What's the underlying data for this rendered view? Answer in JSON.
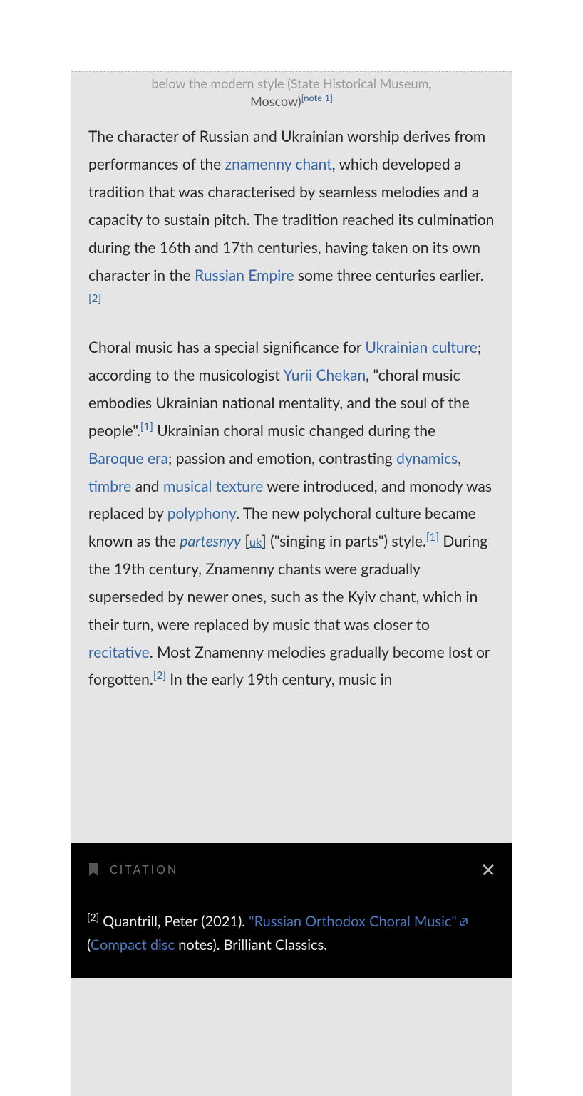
{
  "caption": {
    "line1_prefix": "below the modern style (",
    "link1": "State Historical Museum",
    "line2_after_link": ", Moscow)",
    "note_ref": "[note 1]"
  },
  "para1": {
    "t1": "The character of Russian and Ukrainian worship derives from performances of the ",
    "link_znamenny": "znamenny chant",
    "t2": ", which developed a tradition that was characterised by seamless melodies and a capacity to sustain pitch. The tradition reached its culmination during the 16th and 17th centuries, having taken on its own character in the ",
    "link_russian_empire": "Russian Empire",
    "t3": " some three centuries earlier.",
    "ref2": "[2]"
  },
  "para2": {
    "t1": "Choral music has a special significance for ",
    "link_ukr_culture": "Ukrainian culture",
    "t2": "; according to the musicologist ",
    "link_chek": "Yurii Chekan",
    "t3": ", \"choral music embodies Ukrainian national mentality, and the soul of the people\".",
    "ref1a": "[1]",
    "t4": " Ukrainian choral music changed during the ",
    "link_baroque": "Baroque era",
    "t5": "; passion and emotion, contrasting ",
    "link_dynamics": "dynamics",
    "t6": ", ",
    "link_timbre": "timbre",
    "t7": " and ",
    "link_texture": "musical texture",
    "t8": " were introduced, and monody was replaced by ",
    "link_polyphony": "polyphony",
    "t9": ". The new polychoral culture became known as the ",
    "ital_partesnyy": "partesnyy",
    "t10": " [",
    "uk": "uk",
    "t11": "] (\"singing in parts\") style.",
    "ref1b": "[1]",
    "t12": " During the 19th century, Znamenny chants were gradually superseded by newer ones, such as the Kyiv chant, which in their turn, were replaced by music that was closer to ",
    "link_recitative": "recitative",
    "t13": ". Most Znamenny melodies gradually become lost or forgotten.",
    "ref2b": "[2]",
    "t14": " In the early 19th century, music in"
  },
  "drawer": {
    "title": "CITATION",
    "ref": "[2]",
    "author_year": " Quantrill, Peter (2021). ",
    "quote_link": "\"Russian Orthodox Choral Music\"",
    "paren_open": " (",
    "cd_link": "Compact disc",
    "after_cd": " notes). Brilliant Classics."
  }
}
